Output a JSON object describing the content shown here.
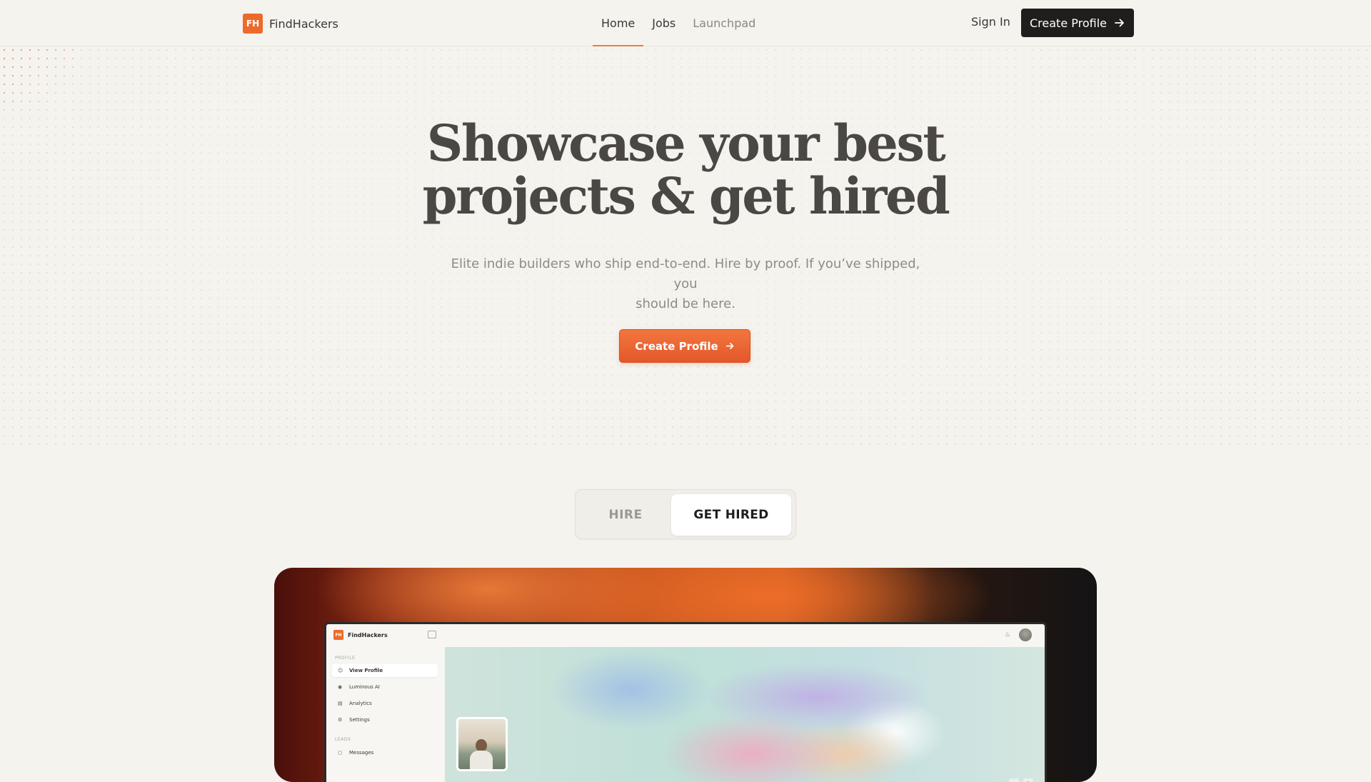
{
  "nav": {
    "logo_badge": "FH",
    "brand": "FindHackers",
    "links": [
      "Home",
      "Jobs",
      "Launchpad"
    ],
    "active_link": "Home",
    "sign_in": "Sign In",
    "cta": "Create Profile"
  },
  "hero": {
    "title_line1": "Showcase your best",
    "title_line2": "projects & get hired",
    "subtitle_line1": "Elite indie builders who ship end-to-end. Hire by proof. If you’ve shipped, you",
    "subtitle_line2": "should be here.",
    "cta": "Create Profile"
  },
  "toggle": {
    "options": [
      "HIRE",
      "GET HIRED"
    ],
    "selected": "GET HIRED"
  },
  "preview": {
    "logo_badge": "FH",
    "brand": "FindHackers",
    "section_profile": "PROFILE",
    "section_leads": "LEADS",
    "items": [
      "View Profile",
      "Luminous AI",
      "Analytics",
      "Settings",
      "Messages"
    ],
    "selected_item": "View Profile"
  },
  "colors": {
    "accent": "#ee6a2b",
    "dark": "#1f1e1c",
    "background": "#f5f3ee"
  }
}
